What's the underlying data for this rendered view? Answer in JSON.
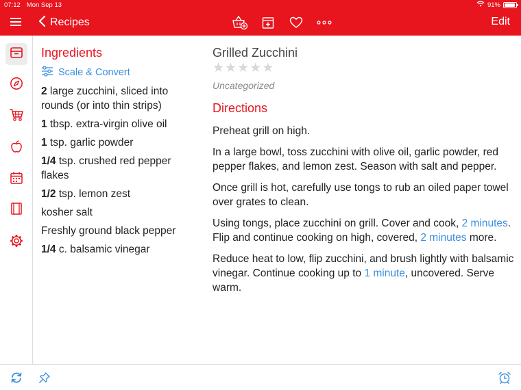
{
  "status_bar": {
    "time": "07:12",
    "date": "Mon Sep 13",
    "battery": "91%",
    "battery_level": 0.91
  },
  "nav": {
    "back_label": "Recipes",
    "edit_label": "Edit"
  },
  "ingredients": {
    "title": "Ingredients",
    "scale_label": "Scale & Convert",
    "items": [
      {
        "qty": "2",
        "text": " large zucchini, sliced into rounds (or into thin strips)"
      },
      {
        "qty": "1",
        "text": " tbsp. extra-virgin olive oil"
      },
      {
        "qty": "1",
        "text": " tsp. garlic powder"
      },
      {
        "qty": "1/4",
        "text": " tsp. crushed red pepper flakes"
      },
      {
        "qty": "1/2",
        "text": " tsp. lemon zest"
      },
      {
        "qty": "",
        "text": "kosher salt"
      },
      {
        "qty": "",
        "text": "Freshly ground black pepper"
      },
      {
        "qty": "1/4",
        "text": " c. balsamic vinegar"
      }
    ]
  },
  "recipe": {
    "title": "Grilled Zucchini",
    "rating": 0,
    "category": "Uncategorized",
    "directions_title": "Directions",
    "steps": [
      {
        "text": "Preheat grill on high."
      },
      {
        "text": "In a large bowl, toss zucchini with olive oil, garlic powder, red pepper flakes, and lemon zest. Season with salt and pepper."
      },
      {
        "text": "Once grill is hot, carefully use tongs to rub an oiled paper towel over grates to clean."
      },
      {
        "pre": "Using tongs, place zucchini on grill. Cover and cook, ",
        "timer1": "2 minutes",
        "mid": ". Flip and continue cooking on high, covered, ",
        "timer2": "2 minutes",
        "post": " more."
      },
      {
        "pre": "Reduce heat to low, flip zucchini, and brush lightly with balsamic vinegar. Continue cooking up to ",
        "timer1": "1 minute",
        "post": ", uncovered. Serve warm."
      }
    ]
  },
  "colors": {
    "accent": "#e8141e",
    "link": "#3a8ee0",
    "star_empty": "#d8d8d8"
  },
  "icons": {
    "nav": [
      "menu-icon",
      "chevron-left-icon",
      "basket-add-icon",
      "add-to-planner-icon",
      "heart-icon",
      "more-icon"
    ],
    "sidebar": [
      "recipe-box-icon",
      "compass-icon",
      "cart-icon",
      "apple-icon",
      "calendar-icon",
      "book-icon",
      "gear-icon"
    ],
    "bottom": [
      "sync-icon",
      "pin-icon",
      "alarm-clock-icon"
    ]
  }
}
